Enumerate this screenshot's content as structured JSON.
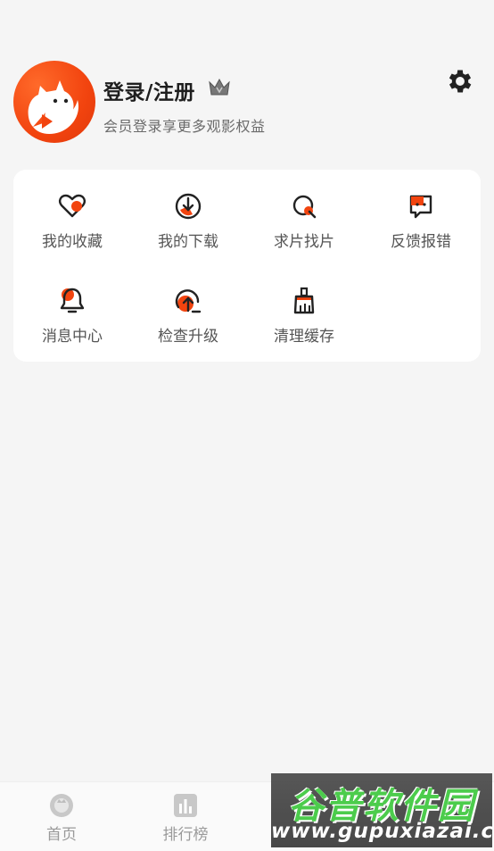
{
  "profile": {
    "login_title": "登录/注册",
    "login_subtitle": "会员登录享更多观影权益"
  },
  "menu": [
    {
      "label": "我的收藏",
      "icon": "heart-icon"
    },
    {
      "label": "我的下载",
      "icon": "download-icon"
    },
    {
      "label": "求片找片",
      "icon": "search-film-icon"
    },
    {
      "label": "反馈报错",
      "icon": "feedback-icon"
    },
    {
      "label": "消息中心",
      "icon": "bell-icon"
    },
    {
      "label": "检查升级",
      "icon": "upgrade-icon"
    },
    {
      "label": "清理缓存",
      "icon": "broom-icon"
    }
  ],
  "tabbar": {
    "home_label": "首页",
    "rank_label": "排行榜"
  },
  "watermark": {
    "title": "谷普软件园",
    "url": "www.gupuxiazai.com"
  },
  "colors": {
    "accent": "#f2440f",
    "background": "#f5f5f5",
    "card": "#ffffff",
    "watermark_green": "#3fc93f"
  }
}
